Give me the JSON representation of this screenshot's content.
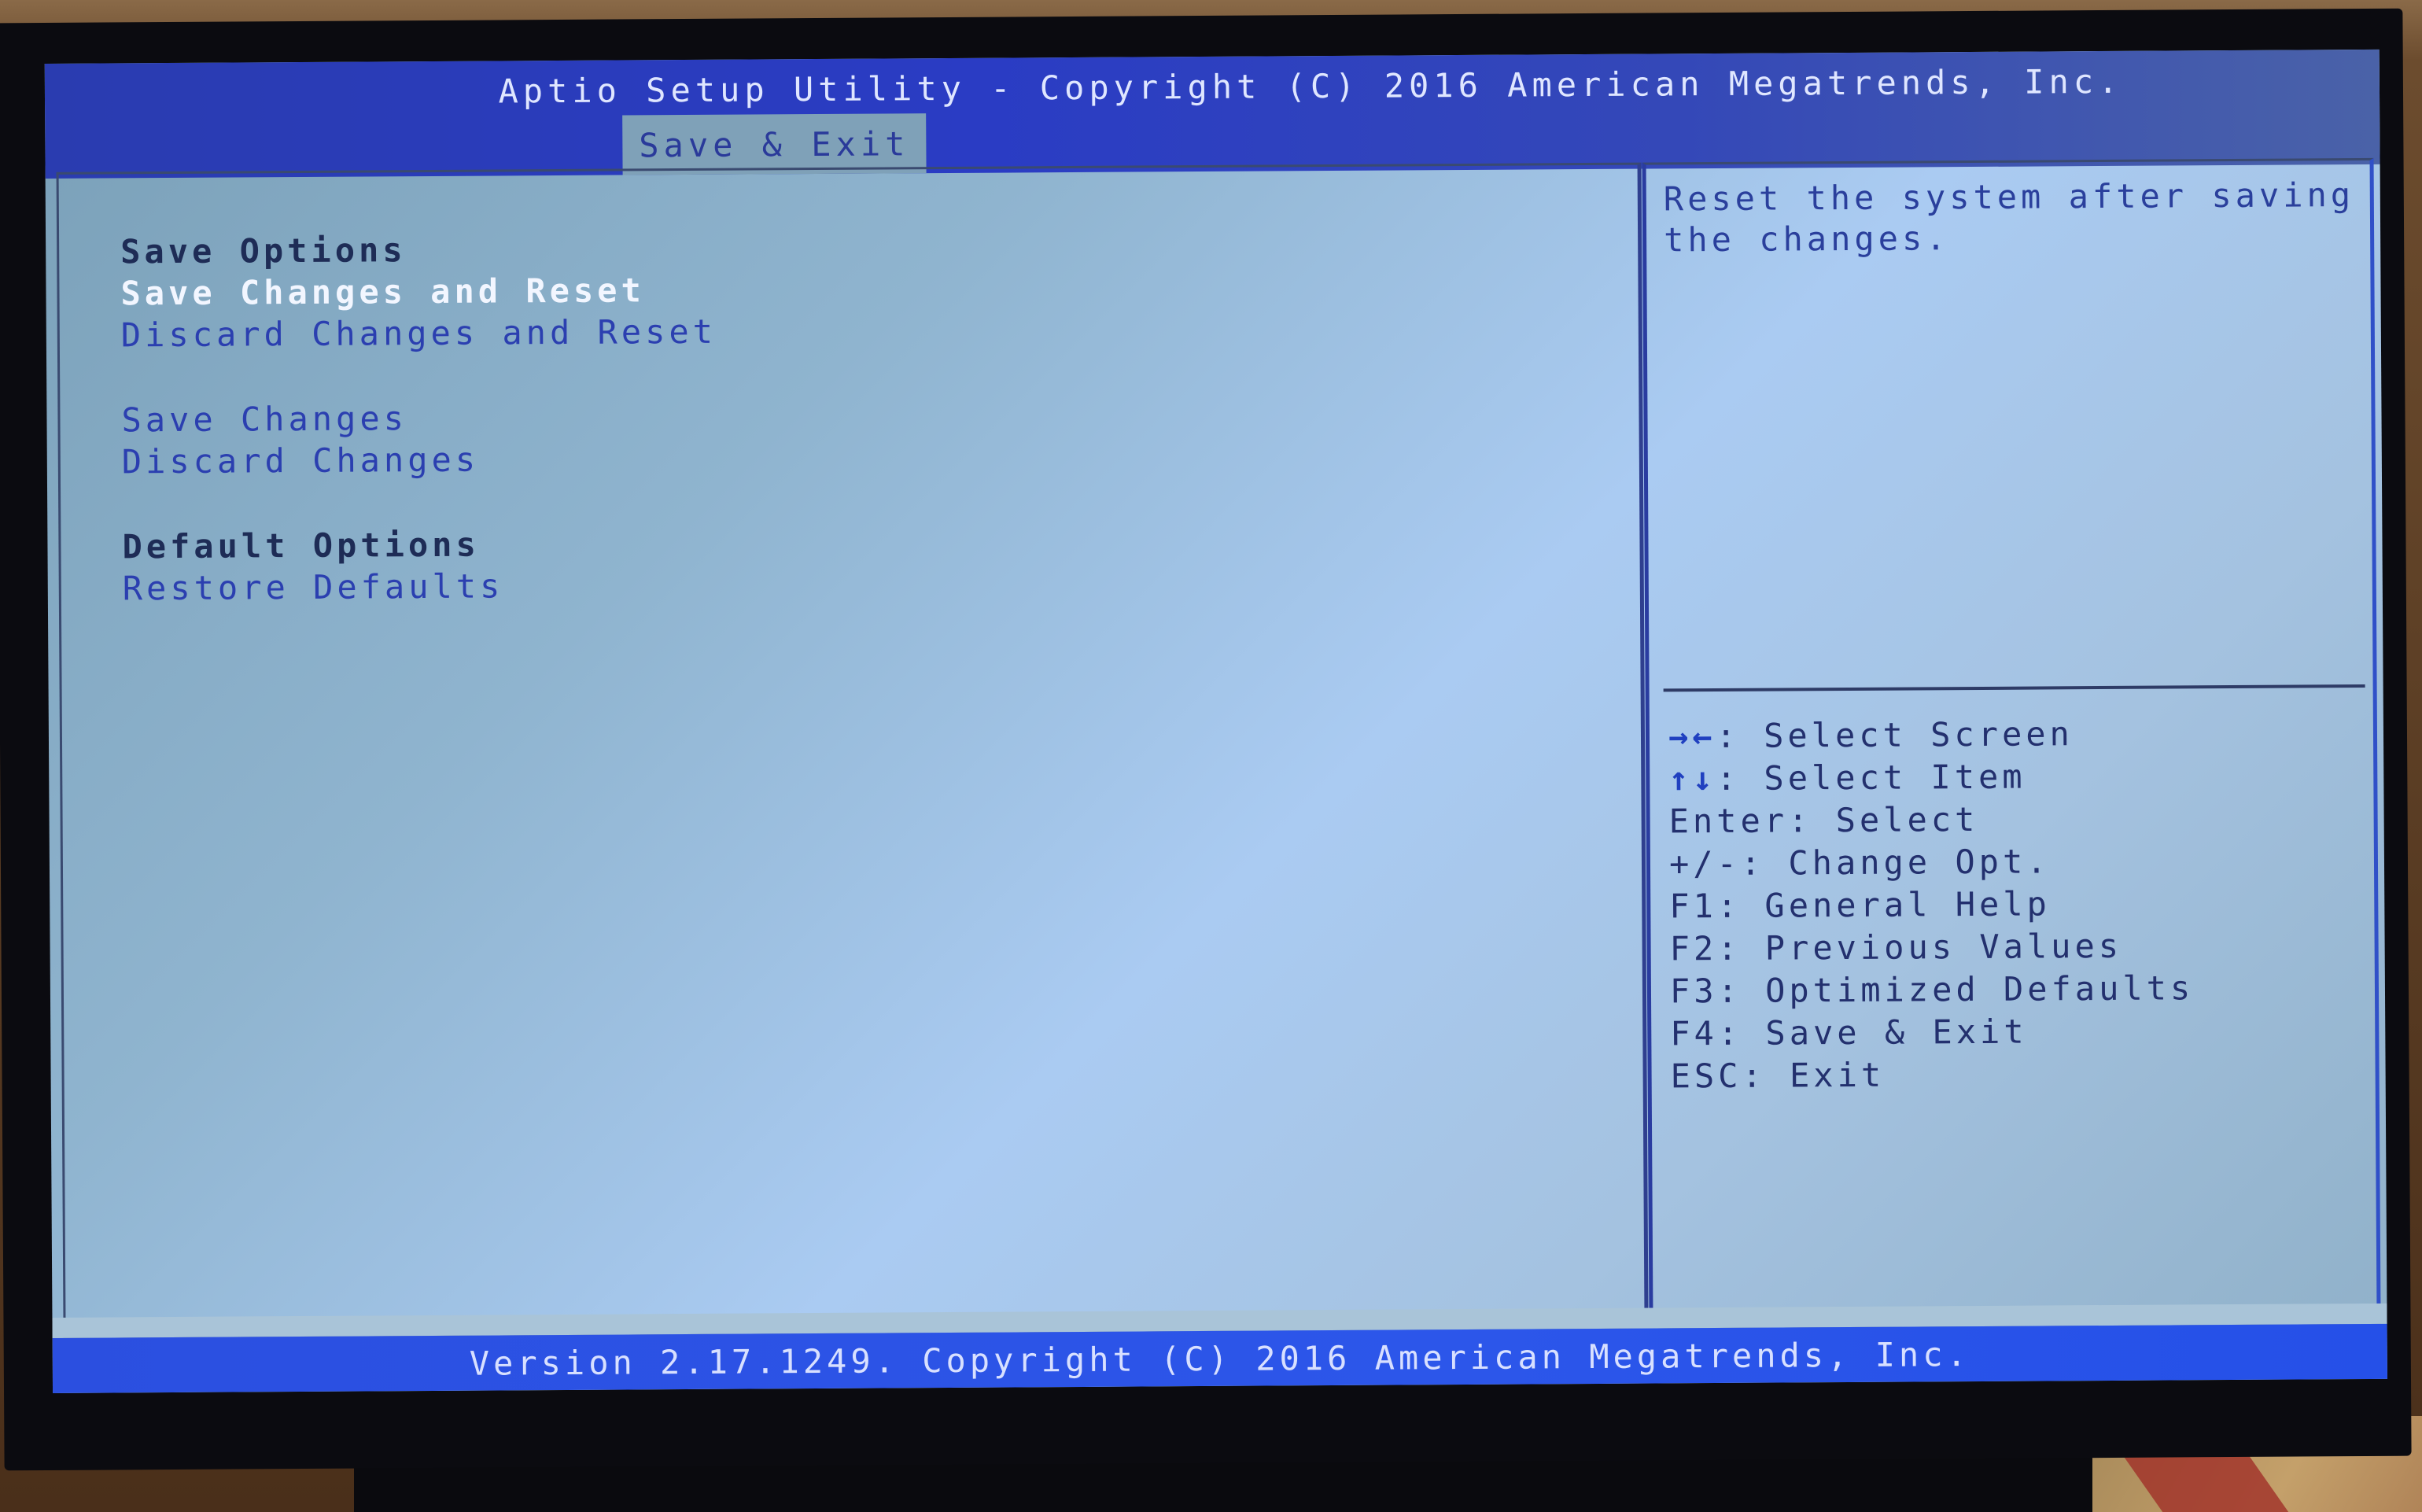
{
  "header": {
    "title": "Aptio Setup Utility - Copyright (C) 2016 American Megatrends, Inc.",
    "active_tab": "Save & Exit"
  },
  "menu": {
    "items": [
      {
        "label": "Save Options",
        "kind": "header"
      },
      {
        "label": "Save Changes and Reset",
        "kind": "selected"
      },
      {
        "label": "Discard Changes and Reset",
        "kind": "option"
      },
      {
        "label": "Save Changes",
        "kind": "option"
      },
      {
        "label": "Discard Changes",
        "kind": "option"
      },
      {
        "label": "Default Options",
        "kind": "header"
      },
      {
        "label": "Restore Defaults",
        "kind": "option"
      }
    ]
  },
  "help": {
    "description": "Reset the system after saving the changes."
  },
  "keys": [
    {
      "key": "→←",
      "desc": ": Select Screen",
      "icon": "left-right-arrows-icon"
    },
    {
      "key": "↑↓",
      "desc": ": Select Item",
      "icon": "up-down-arrows-icon"
    },
    {
      "key": "Enter",
      "desc": ": Select"
    },
    {
      "key": "+/-",
      "desc": ": Change Opt."
    },
    {
      "key": "F1",
      "desc": ": General Help"
    },
    {
      "key": "F2",
      "desc": ": Previous Values"
    },
    {
      "key": "F3",
      "desc": ": Optimized Defaults"
    },
    {
      "key": "F4",
      "desc": ": Save & Exit"
    },
    {
      "key": "ESC",
      "desc": ": Exit"
    }
  ],
  "footer": {
    "text": "Version 2.17.1249. Copyright (C) 2016 American Megatrends, Inc."
  },
  "colors": {
    "header_blue": "#2a3cc4",
    "footer_blue": "#2c56ea",
    "panel_bg": "#aacbf2",
    "selected_text": "#f2f6ff",
    "option_text": "#2b3fb0"
  }
}
